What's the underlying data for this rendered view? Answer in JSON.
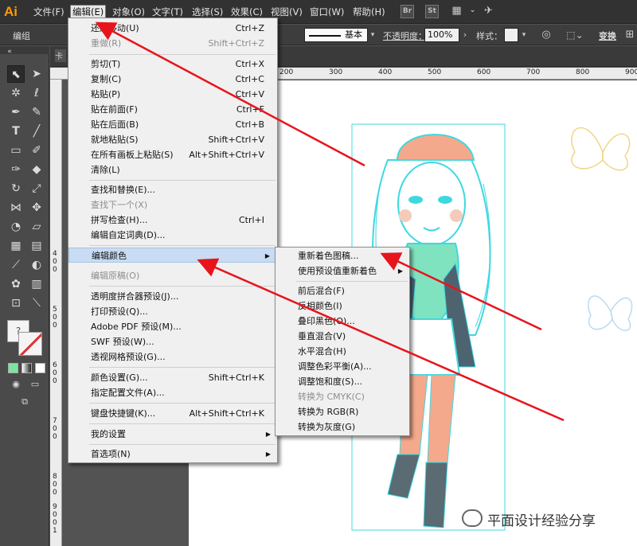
{
  "app": {
    "logo": "Ai"
  },
  "menubar": {
    "items": [
      {
        "label": "文件(F)"
      },
      {
        "label": "编辑(E)"
      },
      {
        "label": "对象(O)"
      },
      {
        "label": "文字(T)"
      },
      {
        "label": "选择(S)"
      },
      {
        "label": "效果(C)"
      },
      {
        "label": "视图(V)"
      },
      {
        "label": "窗口(W)"
      },
      {
        "label": "帮助(H)"
      }
    ],
    "icons": [
      "Br",
      "St"
    ]
  },
  "controlbar": {
    "group_label": "编组",
    "stroke_style_label": "基本",
    "opacity_label": "不透明度：",
    "opacity_value": "100%",
    "style_label": "样式：",
    "transform_label": "变换"
  },
  "ruler": {
    "top_ticks": [
      "200",
      "300",
      "400",
      "500",
      "600",
      "700",
      "800",
      "900"
    ],
    "left_ticks": [
      "4",
      "0",
      "0",
      "5",
      "0",
      "0",
      "6",
      "0",
      "0",
      "7",
      "0",
      "0",
      "8",
      "0",
      "0",
      "9",
      "0",
      "0",
      "1",
      "0",
      "0",
      "0",
      "1",
      "0",
      "0"
    ]
  },
  "tools": {
    "fill_label": "?"
  },
  "edit_menu": {
    "items": [
      {
        "label": "还原移动(U)",
        "shortcut": "Ctrl+Z",
        "disabled": false
      },
      {
        "label": "重做(R)",
        "shortcut": "Shift+Ctrl+Z",
        "disabled": true
      },
      {
        "label": "剪切(T)",
        "shortcut": "Ctrl+X",
        "disabled": false
      },
      {
        "label": "复制(C)",
        "shortcut": "Ctrl+C",
        "disabled": false
      },
      {
        "label": "粘贴(P)",
        "shortcut": "Ctrl+V",
        "disabled": false
      },
      {
        "label": "贴在前面(F)",
        "shortcut": "Ctrl+F",
        "disabled": false
      },
      {
        "label": "贴在后面(B)",
        "shortcut": "Ctrl+B",
        "disabled": false
      },
      {
        "label": "就地粘贴(S)",
        "shortcut": "Shift+Ctrl+V",
        "disabled": false
      },
      {
        "label": "在所有画板上粘贴(S)",
        "shortcut": "Alt+Shift+Ctrl+V",
        "disabled": false
      },
      {
        "label": "清除(L)",
        "shortcut": "",
        "disabled": false
      },
      {
        "label": "查找和替换(E)...",
        "shortcut": "",
        "disabled": false
      },
      {
        "label": "查找下一个(X)",
        "shortcut": "",
        "disabled": true
      },
      {
        "label": "拼写检查(H)...",
        "shortcut": "Ctrl+I",
        "disabled": false
      },
      {
        "label": "编辑自定词典(D)...",
        "shortcut": "",
        "disabled": false
      },
      {
        "label": "编辑颜色",
        "shortcut": "",
        "disabled": false
      },
      {
        "label": "编辑原稿(O)",
        "shortcut": "",
        "disabled": true
      },
      {
        "label": "透明度拼合器预设(J)...",
        "shortcut": "",
        "disabled": false
      },
      {
        "label": "打印预设(Q)...",
        "shortcut": "",
        "disabled": false
      },
      {
        "label": "Adobe PDF 预设(M)...",
        "shortcut": "",
        "disabled": false
      },
      {
        "label": "SWF 预设(W)...",
        "shortcut": "",
        "disabled": false
      },
      {
        "label": "透视网格预设(G)...",
        "shortcut": "",
        "disabled": false
      },
      {
        "label": "颜色设置(G)...",
        "shortcut": "Shift+Ctrl+K",
        "disabled": false
      },
      {
        "label": "指定配置文件(A)...",
        "shortcut": "",
        "disabled": false
      },
      {
        "label": "键盘快捷键(K)...",
        "shortcut": "Alt+Shift+Ctrl+K",
        "disabled": false
      },
      {
        "label": "我的设置",
        "shortcut": "",
        "disabled": false
      },
      {
        "label": "首选项(N)",
        "shortcut": "",
        "disabled": false
      }
    ]
  },
  "color_menu": {
    "items": [
      {
        "label": "重新着色图稿...",
        "disabled": false
      },
      {
        "label": "使用预设值重新着色",
        "disabled": false
      },
      {
        "label": "前后混合(F)",
        "disabled": false
      },
      {
        "label": "反相颜色(I)",
        "disabled": false
      },
      {
        "label": "叠印黑色(O)...",
        "disabled": false
      },
      {
        "label": "垂直混合(V)",
        "disabled": false
      },
      {
        "label": "水平混合(H)",
        "disabled": false
      },
      {
        "label": "调整色彩平衡(A)...",
        "disabled": false
      },
      {
        "label": "调整饱和度(S)...",
        "disabled": false
      },
      {
        "label": "转换为 CMYK(C)",
        "disabled": true
      },
      {
        "label": "转换为 RGB(R)",
        "disabled": false
      },
      {
        "label": "转换为灰度(G)",
        "disabled": false
      }
    ]
  },
  "colors": {
    "arrow": "#e8141c",
    "hair_outline": "#3fd8e0",
    "skin": "#f4a98c",
    "scarf": "#7fe3c0"
  },
  "watermark": {
    "text": "平面设计经验分享"
  }
}
